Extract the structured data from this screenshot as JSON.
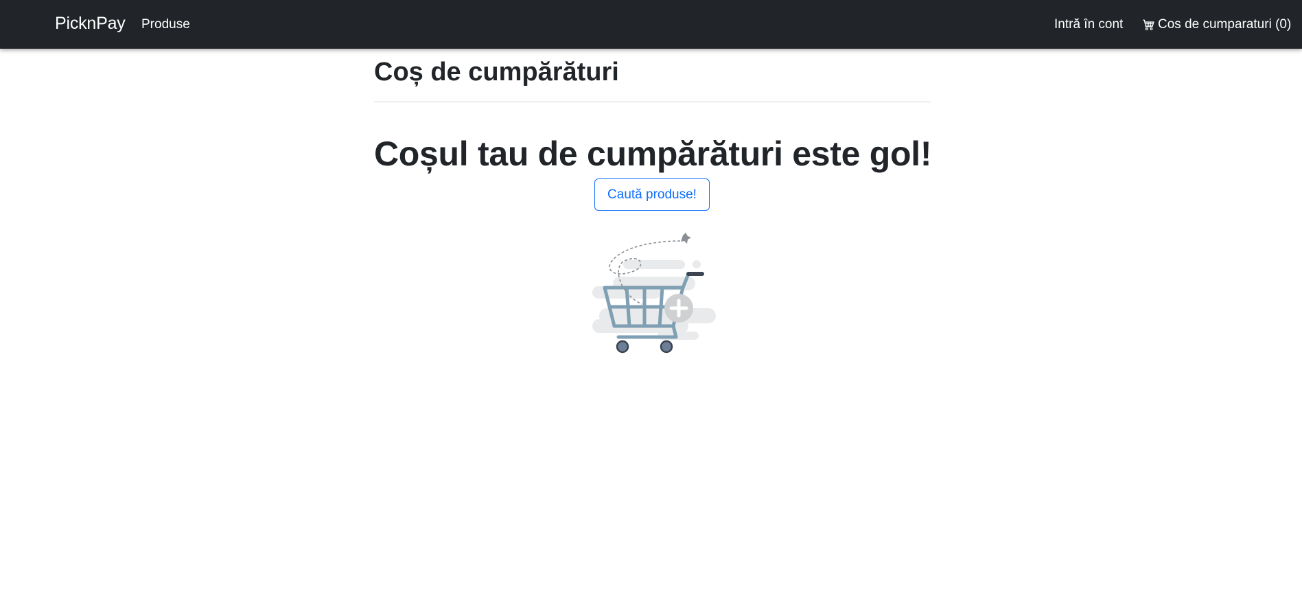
{
  "navbar": {
    "brand": "PicknPay",
    "products_label": "Produse",
    "login_label": "Intră în cont",
    "cart_label": "Cos de cumparaturi (0)",
    "background": "#212529"
  },
  "main": {
    "page_title": "Coș de cumpărături",
    "empty_message": "Coșul tau de cumpărături este gol!",
    "search_button_label": "Caută produse!",
    "illustration": "empty-cart-illustration",
    "accent_color": "#0d6efd"
  }
}
